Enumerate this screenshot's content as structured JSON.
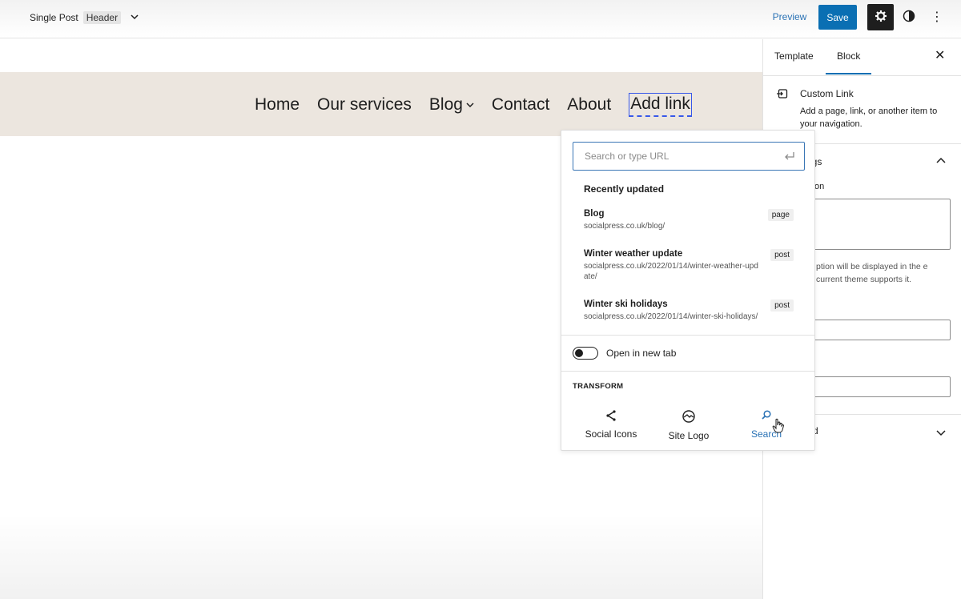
{
  "topbar": {
    "doc_title": "Single Post",
    "doc_badge": "Header",
    "preview_label": "Preview",
    "save_label": "Save"
  },
  "nav": {
    "items": [
      "Home",
      "Our services",
      "Blog",
      "Contact",
      "About",
      "Add link"
    ]
  },
  "link_popover": {
    "search_placeholder": "Search or type URL",
    "recent_title": "Recently updated",
    "results": [
      {
        "title": "Blog",
        "url": "socialpress.co.uk/blog/",
        "type": "page"
      },
      {
        "title": "Winter weather update",
        "url": "socialpress.co.uk/2022/01/14/winter-weather-update/",
        "type": "post"
      },
      {
        "title": "Winter ski holidays",
        "url": "socialpress.co.uk/2022/01/14/winter-ski-holidays/",
        "type": "post"
      }
    ],
    "open_new_tab_label": "Open in new tab",
    "open_new_tab": false,
    "transform_label": "TRANSFORM",
    "transforms": [
      {
        "label": "Social Icons",
        "icon": "share-icon"
      },
      {
        "label": "Site Logo",
        "icon": "site-logo-icon"
      },
      {
        "label": "Search",
        "icon": "search-icon"
      }
    ]
  },
  "sidebar": {
    "tabs": [
      "Template",
      "Block"
    ],
    "active_tab": "Block",
    "block_title": "Custom Link",
    "block_description": "Add a page, link, or another item to your navigation.",
    "settings_title_partial": "ngs",
    "description_label_partial": "on",
    "help_text_partial": "ption will be displayed in the e current theme supports it.",
    "advanced_title_partial": "d"
  },
  "colors": {
    "accent": "#0a6fb3",
    "header_band": "#ece6df",
    "link_blue": "#2a72b5"
  }
}
